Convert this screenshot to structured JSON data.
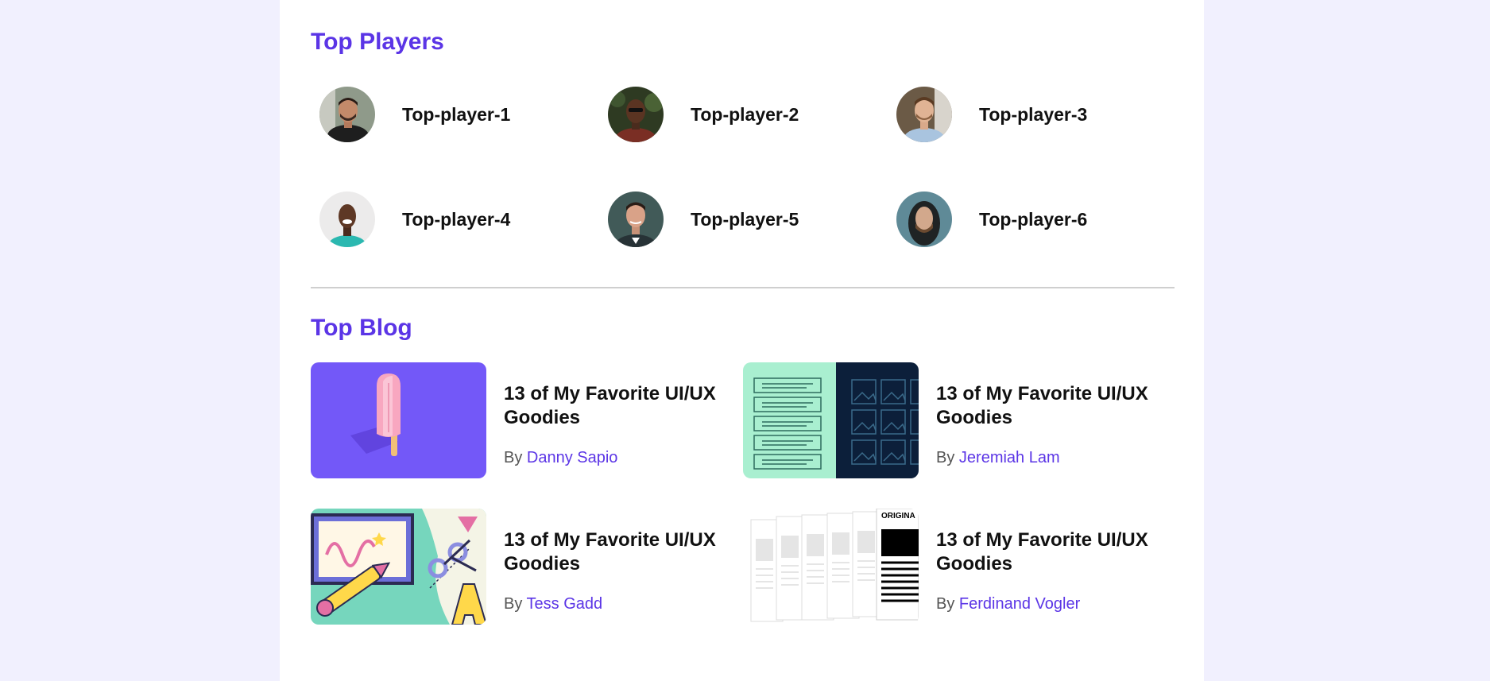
{
  "players_section": {
    "title": "Top Players",
    "players": [
      {
        "name": "Top-player-1",
        "avatar_icon": "player-photo"
      },
      {
        "name": "Top-player-2",
        "avatar_icon": "player-photo"
      },
      {
        "name": "Top-player-3",
        "avatar_icon": "player-photo"
      },
      {
        "name": "Top-player-4",
        "avatar_icon": "player-photo"
      },
      {
        "name": "Top-player-5",
        "avatar_icon": "player-photo"
      },
      {
        "name": "Top-player-6",
        "avatar_icon": "player-photo"
      }
    ]
  },
  "blog_section": {
    "title": "Top Blog",
    "by_prefix": "By",
    "posts": [
      {
        "title": "13 of My Favorite UI/UX Goodies",
        "author": "Danny Sapio",
        "thumb_icon": "popsicle-illustration"
      },
      {
        "title": "13 of My Favorite UI/UX Goodies",
        "author": "Jeremiah Lam",
        "thumb_icon": "wireframe-illustration"
      },
      {
        "title": "13 of My Favorite UI/UX Goodies",
        "author": "Tess Gadd",
        "thumb_icon": "crafts-illustration"
      },
      {
        "title": "13 of My Favorite UI/UX Goodies",
        "author": "Ferdinand Vogler",
        "thumb_icon": "newspaper-stack-illustration",
        "thumb_text": "ORIGINA"
      }
    ]
  },
  "colors": {
    "accent": "#5b35e6",
    "page_background": "#f1f0fe",
    "card_background": "#ffffff"
  }
}
